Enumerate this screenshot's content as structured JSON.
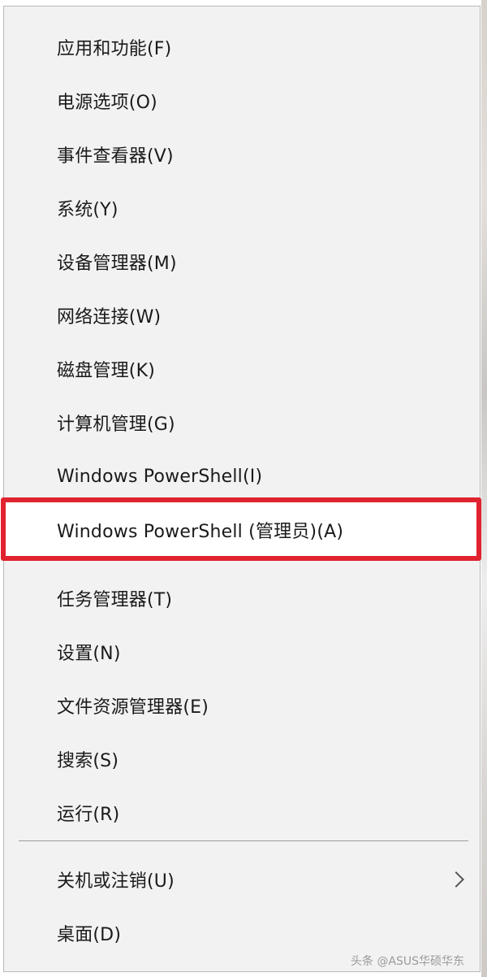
{
  "menu": {
    "items": [
      {
        "label": "应用和功能(F)"
      },
      {
        "label": "电源选项(O)"
      },
      {
        "label": "事件查看器(V)"
      },
      {
        "label": "系统(Y)"
      },
      {
        "label": "设备管理器(M)"
      },
      {
        "label": "网络连接(W)"
      },
      {
        "label": "磁盘管理(K)"
      },
      {
        "label": "计算机管理(G)"
      },
      {
        "label": "Windows PowerShell(I)"
      },
      {
        "label": "Windows PowerShell (管理员)(A)"
      },
      {
        "label": "任务管理器(T)"
      },
      {
        "label": "设置(N)"
      },
      {
        "label": "文件资源管理器(E)"
      },
      {
        "label": "搜索(S)"
      },
      {
        "label": "运行(R)"
      },
      {
        "label": "关机或注销(U)"
      },
      {
        "label": "桌面(D)"
      }
    ]
  },
  "icons": {
    "submenu_arrow": "chevron-right-icon"
  },
  "colors": {
    "highlight_border": "#e0232e",
    "menu_background": "#f2f2f2",
    "text": "#1a1a1a"
  },
  "watermark": {
    "text": "头条 @ASUS华硕华东"
  }
}
